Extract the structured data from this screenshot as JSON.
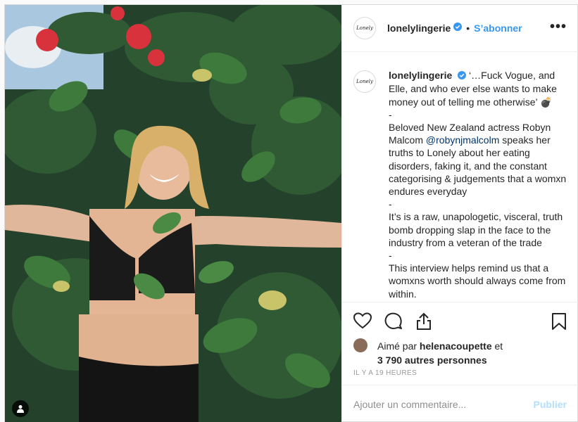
{
  "post": {
    "author": {
      "username": "lonelylingerie",
      "avatar_text": "Lonely",
      "verified": true
    },
    "follow_label": "S’abonner",
    "separator": "•",
    "more_label": "•••",
    "caption": {
      "lines": [
        "‘…Fuck Vogue, and Elle, and who ever else wants to make money out of telling me otherwise’ 💣",
        "-",
        "Beloved New Zealand actress Robyn Malcom",
        "@robynjmalcolm",
        "speaks her truths to Lonely about her eating disorders, faking it, and the constant categorising & judgements that a womxn endures everyday",
        "-",
        "It’s is a raw, unapologetic, visceral, truth bomb dropping slap in the face to the industry from a veteran of the trade",
        "-",
        "This interview helps remind us that a womxns worth should always come from within."
      ]
    },
    "likes": {
      "prefix": "Aimé par",
      "liker": "helenacoupette",
      "connector": "et",
      "others": "3 790 autres personnes"
    },
    "timestamp": "IL Y A 19 HEURES",
    "comment": {
      "placeholder": "Ajouter un commentaire...",
      "publish_label": "Publier"
    },
    "icons": {
      "like": "heart-icon",
      "comment": "comment-bubble-icon",
      "share": "share-icon",
      "save": "bookmark-icon",
      "verified": "verified-badge-icon",
      "tag": "user-tag-icon"
    },
    "colors": {
      "accent": "#3897f0",
      "publish_disabled": "#b2dffc",
      "text": "#262626",
      "muted": "#8e8e8e",
      "border": "#efefef"
    }
  }
}
